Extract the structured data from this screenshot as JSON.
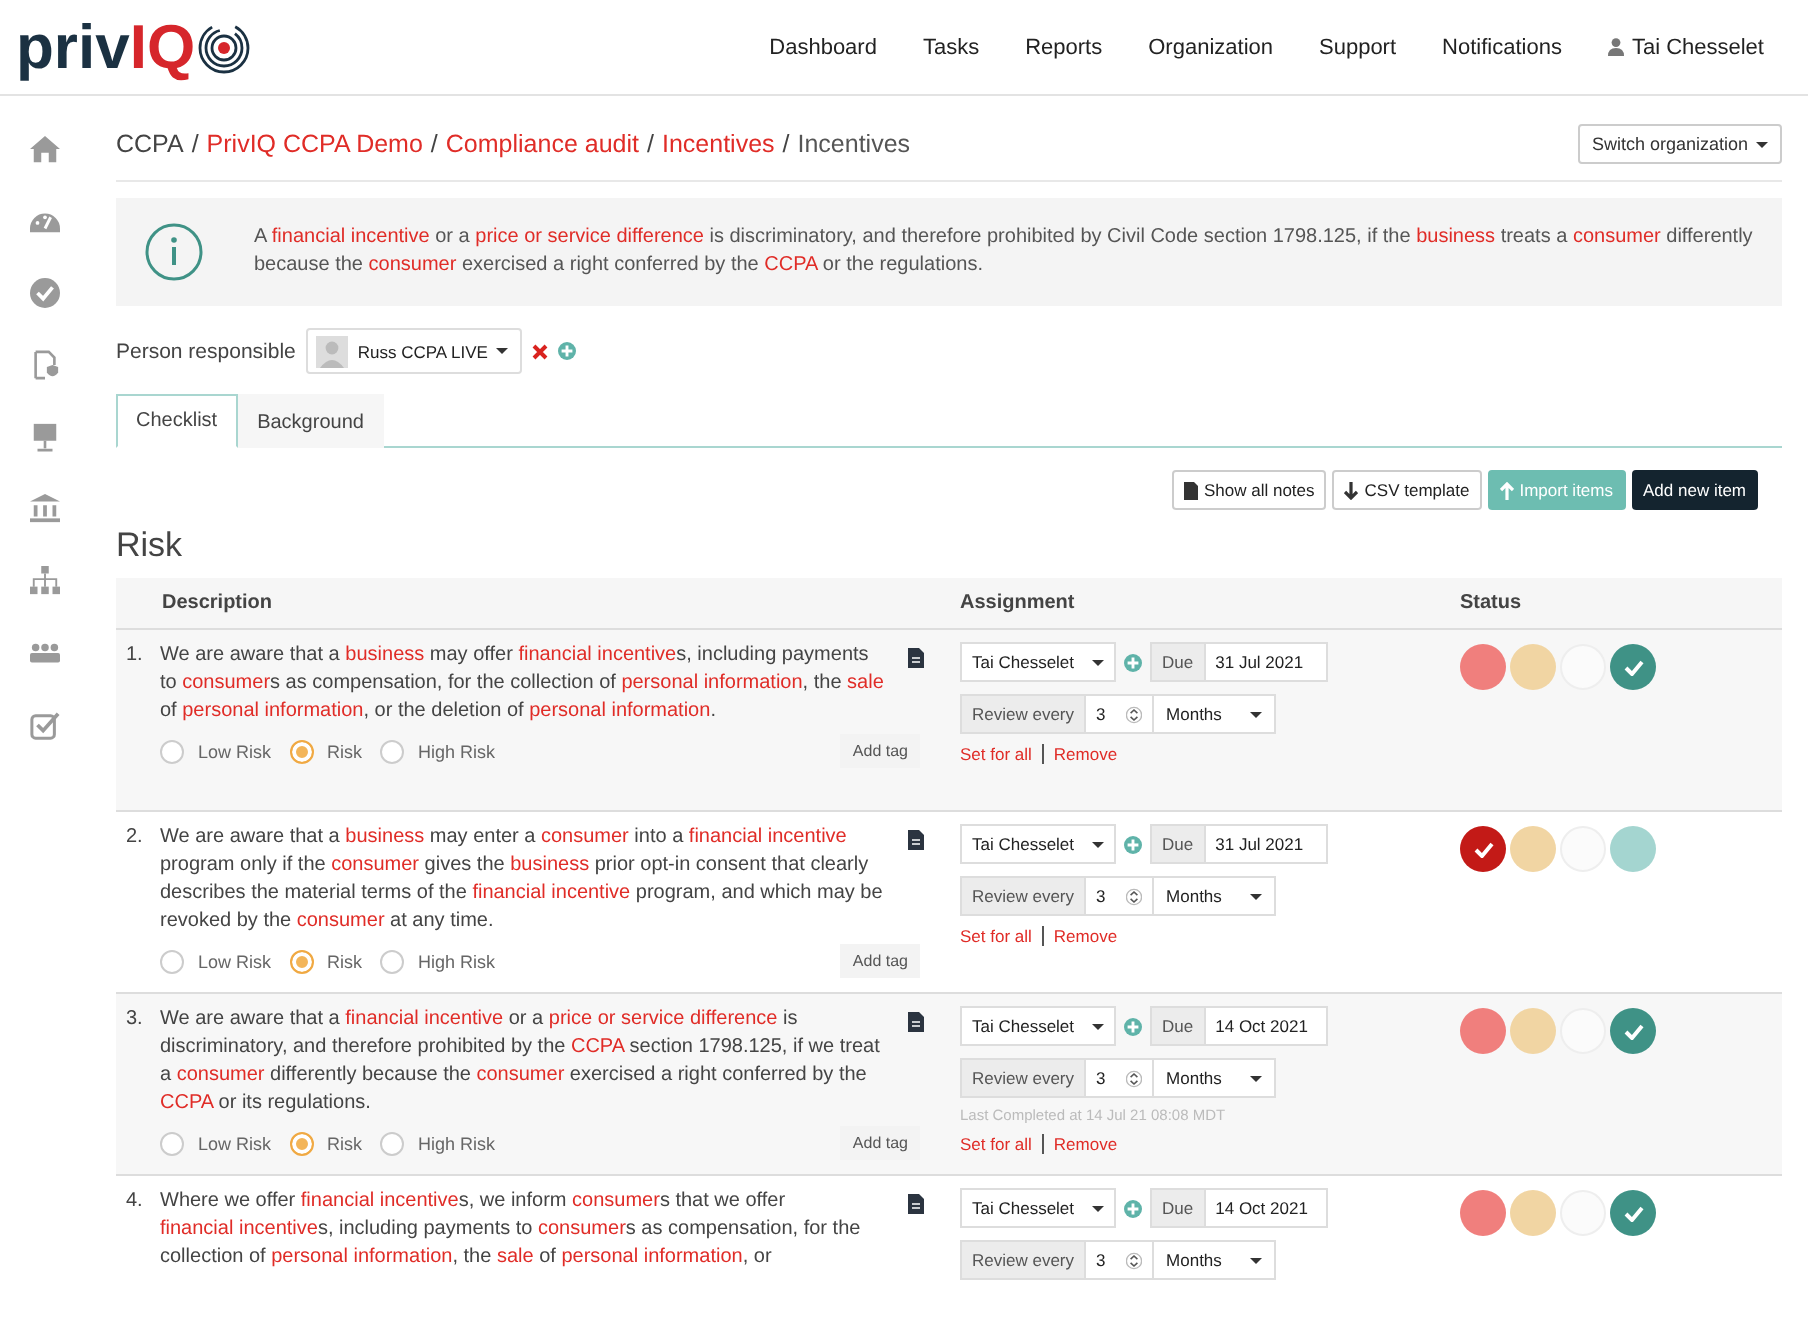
{
  "logo": {
    "parts": [
      {
        "text": "priv",
        "accent": false
      },
      {
        "text": "IQ",
        "accent": true
      }
    ]
  },
  "nav": [
    {
      "label": "Dashboard",
      "kind": "link"
    },
    {
      "label": "Tasks",
      "kind": "link"
    },
    {
      "label": "Reports",
      "kind": "link"
    },
    {
      "label": "Organization",
      "kind": "link"
    },
    {
      "label": "Support",
      "kind": "link"
    },
    {
      "label": "Notifications",
      "kind": "link"
    },
    {
      "label": "Tai Chesselet",
      "kind": "user"
    }
  ],
  "breadcrumb": [
    {
      "kind": "plain",
      "text": "CCPA"
    },
    {
      "kind": "separator",
      "text": "/"
    },
    {
      "kind": "link",
      "text": "PrivIQ CCPA Demo"
    },
    {
      "kind": "separator",
      "text": "/"
    },
    {
      "kind": "link",
      "text": "Compliance audit"
    },
    {
      "kind": "separator",
      "text": "/"
    },
    {
      "kind": "link",
      "text": "Incentives"
    },
    {
      "kind": "separator",
      "text": "/"
    },
    {
      "kind": "current",
      "text": "Incentives"
    }
  ],
  "switch_organization": "Switch organization",
  "banner": [
    {
      "text": "A ",
      "term": false
    },
    {
      "text": "financial incentive",
      "term": true
    },
    {
      "text": " or a ",
      "term": false
    },
    {
      "text": "price or service difference",
      "term": true
    },
    {
      "text": " is discriminatory, and therefore prohibited by Civil Code section 1798.125, if the ",
      "term": false
    },
    {
      "text": "business",
      "term": true
    },
    {
      "text": " treats a ",
      "term": false
    },
    {
      "text": "consumer",
      "term": true
    },
    {
      "text": " differently because the ",
      "term": false
    },
    {
      "text": "consumer",
      "term": true
    },
    {
      "text": " exercised a right conferred by the ",
      "term": false
    },
    {
      "text": "CCPA",
      "term": true
    },
    {
      "text": " or the regulations.",
      "term": false
    }
  ],
  "person_responsible": {
    "label": "Person responsible",
    "value": "Russ CCPA LIVE"
  },
  "tabs": [
    {
      "label": "Checklist",
      "selected": true
    },
    {
      "label": "Background",
      "selected": false
    }
  ],
  "toolbar": [
    {
      "label": "Show all notes",
      "kind": "notes"
    },
    {
      "label": "CSV template",
      "kind": "download"
    },
    {
      "label": "Import items",
      "kind": "import"
    },
    {
      "label": "Add new item",
      "kind": "add"
    }
  ],
  "section_title": "Risk",
  "columns": [
    "Description",
    "Assignment",
    "Status"
  ],
  "rows": [
    {
      "number": "1.",
      "description": [
        {
          "text": "We are aware that a ",
          "term": false
        },
        {
          "text": "business",
          "term": true
        },
        {
          "text": " may offer ",
          "term": false
        },
        {
          "text": "financial incentive",
          "term": true
        },
        {
          "text": "s, including payments to ",
          "term": false
        },
        {
          "text": "consumer",
          "term": true
        },
        {
          "text": "s as compensation, for the collection of ",
          "term": false
        },
        {
          "text": "personal information",
          "term": true
        },
        {
          "text": ", the ",
          "term": false
        },
        {
          "text": "sale",
          "term": true
        },
        {
          "text": " of ",
          "term": false
        },
        {
          "text": "personal information",
          "term": true
        },
        {
          "text": ", or the deletion of ",
          "term": false
        },
        {
          "text": "personal information",
          "term": true
        },
        {
          "text": ".",
          "term": false
        }
      ],
      "risk": [
        {
          "label": "Low Risk",
          "selected": false
        },
        {
          "label": "Risk",
          "selected": true
        },
        {
          "label": "High Risk",
          "selected": false
        }
      ],
      "add_tag": "Add tag",
      "assignee": "Tai Chesselet",
      "due_label": "Due",
      "due": "31 Jul 2021",
      "review_label": "Review every",
      "review_value": "3",
      "review_unit": "Months",
      "last_completed": "",
      "links": [
        "Set for all",
        "Remove"
      ],
      "statuses": [
        {
          "kind": "risk",
          "selected": false
        },
        {
          "kind": "warning",
          "selected": false
        },
        {
          "kind": "blank",
          "selected": false
        },
        {
          "kind": "done",
          "selected": true
        }
      ]
    },
    {
      "number": "2.",
      "description": [
        {
          "text": "We are aware that a ",
          "term": false
        },
        {
          "text": "business",
          "term": true
        },
        {
          "text": " may enter a ",
          "term": false
        },
        {
          "text": "consumer",
          "term": true
        },
        {
          "text": " into a ",
          "term": false
        },
        {
          "text": "financial incentive",
          "term": true
        },
        {
          "text": " program only if the ",
          "term": false
        },
        {
          "text": "consumer",
          "term": true
        },
        {
          "text": " gives the ",
          "term": false
        },
        {
          "text": "business",
          "term": true
        },
        {
          "text": " prior opt-in consent that clearly describes the material terms of the ",
          "term": false
        },
        {
          "text": "financial incentive",
          "term": true
        },
        {
          "text": " program, and which may be revoked by the ",
          "term": false
        },
        {
          "text": "consumer",
          "term": true
        },
        {
          "text": " at any time.",
          "term": false
        }
      ],
      "risk": [
        {
          "label": "Low Risk",
          "selected": false
        },
        {
          "label": "Risk",
          "selected": true
        },
        {
          "label": "High Risk",
          "selected": false
        }
      ],
      "add_tag": "Add tag",
      "assignee": "Tai Chesselet",
      "due_label": "Due",
      "due": "31 Jul 2021",
      "review_label": "Review every",
      "review_value": "3",
      "review_unit": "Months",
      "last_completed": "",
      "links": [
        "Set for all",
        "Remove"
      ],
      "statuses": [
        {
          "kind": "risk",
          "selected": true
        },
        {
          "kind": "warning",
          "selected": false
        },
        {
          "kind": "blank",
          "selected": false
        },
        {
          "kind": "done",
          "selected": false
        }
      ]
    },
    {
      "number": "3.",
      "description": [
        {
          "text": "We are aware that a ",
          "term": false
        },
        {
          "text": "financial incentive",
          "term": true
        },
        {
          "text": " or a ",
          "term": false
        },
        {
          "text": "price or service difference",
          "term": true
        },
        {
          "text": " is discriminatory, and therefore prohibited by the ",
          "term": false
        },
        {
          "text": "CCPA",
          "term": true
        },
        {
          "text": " section 1798.125, if we treat a ",
          "term": false
        },
        {
          "text": "consumer",
          "term": true
        },
        {
          "text": " differently because the ",
          "term": false
        },
        {
          "text": "consumer",
          "term": true
        },
        {
          "text": " exercised a right conferred by the ",
          "term": false
        },
        {
          "text": "CCPA",
          "term": true
        },
        {
          "text": " or its regulations.",
          "term": false
        }
      ],
      "risk": [
        {
          "label": "Low Risk",
          "selected": false
        },
        {
          "label": "Risk",
          "selected": true
        },
        {
          "label": "High Risk",
          "selected": false
        }
      ],
      "add_tag": "Add tag",
      "assignee": "Tai Chesselet",
      "due_label": "Due",
      "due": "14 Oct 2021",
      "review_label": "Review every",
      "review_value": "3",
      "review_unit": "Months",
      "last_completed": "Last Completed at 14 Jul 21 08:08 MDT",
      "links": [
        "Set for all",
        "Remove"
      ],
      "statuses": [
        {
          "kind": "risk",
          "selected": false
        },
        {
          "kind": "warning",
          "selected": false
        },
        {
          "kind": "blank",
          "selected": false
        },
        {
          "kind": "done",
          "selected": true
        }
      ]
    },
    {
      "number": "4.",
      "description": [
        {
          "text": "Where we offer ",
          "term": false
        },
        {
          "text": "financial incentive",
          "term": true
        },
        {
          "text": "s, we inform ",
          "term": false
        },
        {
          "text": "consumer",
          "term": true
        },
        {
          "text": "s that we offer ",
          "term": false
        },
        {
          "text": "financial incentive",
          "term": true
        },
        {
          "text": "s, including payments to ",
          "term": false
        },
        {
          "text": "consumer",
          "term": true
        },
        {
          "text": "s as compensation, for the collection of ",
          "term": false
        },
        {
          "text": "personal information",
          "term": true
        },
        {
          "text": ", the ",
          "term": false
        },
        {
          "text": "sale",
          "term": true
        },
        {
          "text": " of ",
          "term": false
        },
        {
          "text": "personal information",
          "term": true
        },
        {
          "text": ", or",
          "term": false
        }
      ],
      "risk": [],
      "add_tag": "",
      "assignee": "Tai Chesselet",
      "due_label": "Due",
      "due": "14 Oct 2021",
      "review_label": "Review every",
      "review_value": "3",
      "review_unit": "Months",
      "last_completed": "",
      "links": [],
      "statuses": [
        {
          "kind": "risk",
          "selected": false
        },
        {
          "kind": "warning",
          "selected": false
        },
        {
          "kind": "blank",
          "selected": false
        },
        {
          "kind": "done",
          "selected": true
        }
      ]
    }
  ]
}
